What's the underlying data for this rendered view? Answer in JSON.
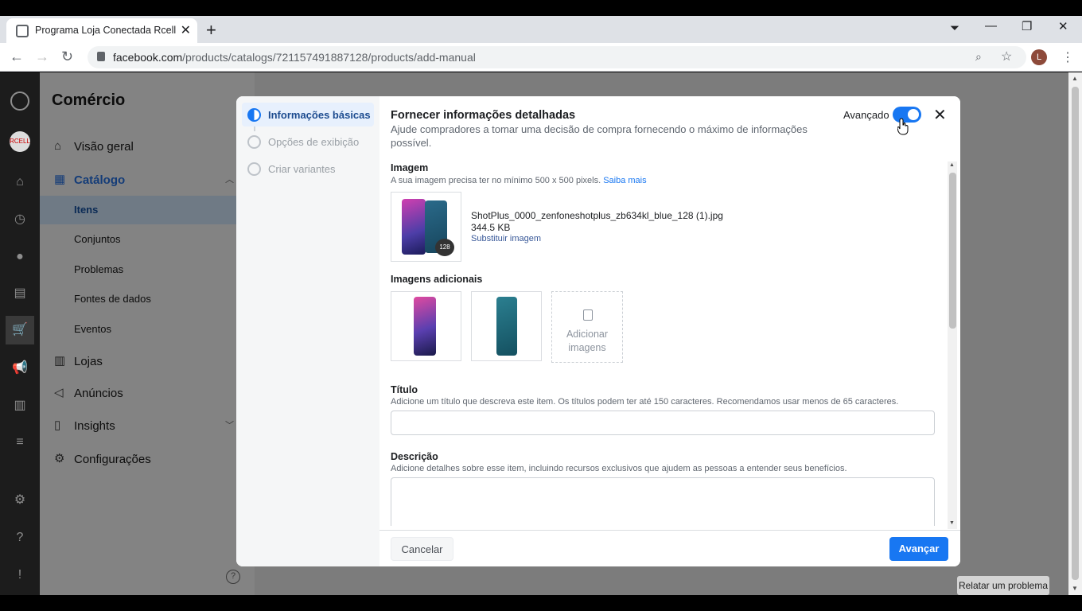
{
  "browser": {
    "tab_title": "Programa Loja Conectada Rcell",
    "url_domain": "facebook.com",
    "url_path": "/products/catalogs/721157491887128/products/add-manual",
    "profile_initial": "L"
  },
  "sidebar": {
    "heading": "Comércio",
    "items": [
      {
        "label": "Visão geral",
        "icon": "home-icon"
      },
      {
        "label": "Catálogo",
        "icon": "grid-icon"
      },
      {
        "label": "Lojas",
        "icon": "shop-icon"
      },
      {
        "label": "Anúncios",
        "icon": "megaphone-icon"
      },
      {
        "label": "Insights",
        "icon": "chart-icon"
      },
      {
        "label": "Configurações",
        "icon": "gear-icon"
      }
    ],
    "catalog_sub": [
      "Itens",
      "Conjuntos",
      "Problemas",
      "Fontes de dados",
      "Eventos"
    ],
    "help": "?"
  },
  "report_button": "Relatar um problema",
  "modal": {
    "steps": [
      "Informações básicas",
      "Opções de exibição",
      "Criar variantes"
    ],
    "title": "Fornecer informações detalhadas",
    "subtitle": "Ajude compradores a tomar uma decisão de compra fornecendo o máximo de informações possível.",
    "advanced_label": "Avançado",
    "advanced_on": true,
    "image": {
      "title": "Imagem",
      "hint": "A sua imagem precisa ter no mínimo 500 x 500 pixels.",
      "hint_link": "Saiba mais",
      "file_name": "ShotPlus_0000_zenfoneshotplus_zb634kl_blue_128 (1).jpg",
      "file_size": "344.5 KB",
      "replace_link": "Substituir imagem",
      "badge": "128"
    },
    "additional_images": {
      "title": "Imagens adicionais",
      "add_label": "Adicionar imagens"
    },
    "title_field": {
      "label": "Título",
      "hint": "Adicione um título que descreva este item. Os títulos podem ter até 150 caracteres. Recomendamos usar menos de 65 caracteres.",
      "value": ""
    },
    "description_field": {
      "label": "Descrição",
      "hint": "Adicione detalhes sobre esse item, incluindo recursos exclusivos que ajudem as pessoas a entender seus benefícios.",
      "value": ""
    },
    "cancel_label": "Cancelar",
    "next_label": "Avançar"
  },
  "colors": {
    "primary": "#1877f2",
    "sidebar_bg": "#838383",
    "rail_bg": "#1c1c1c"
  }
}
